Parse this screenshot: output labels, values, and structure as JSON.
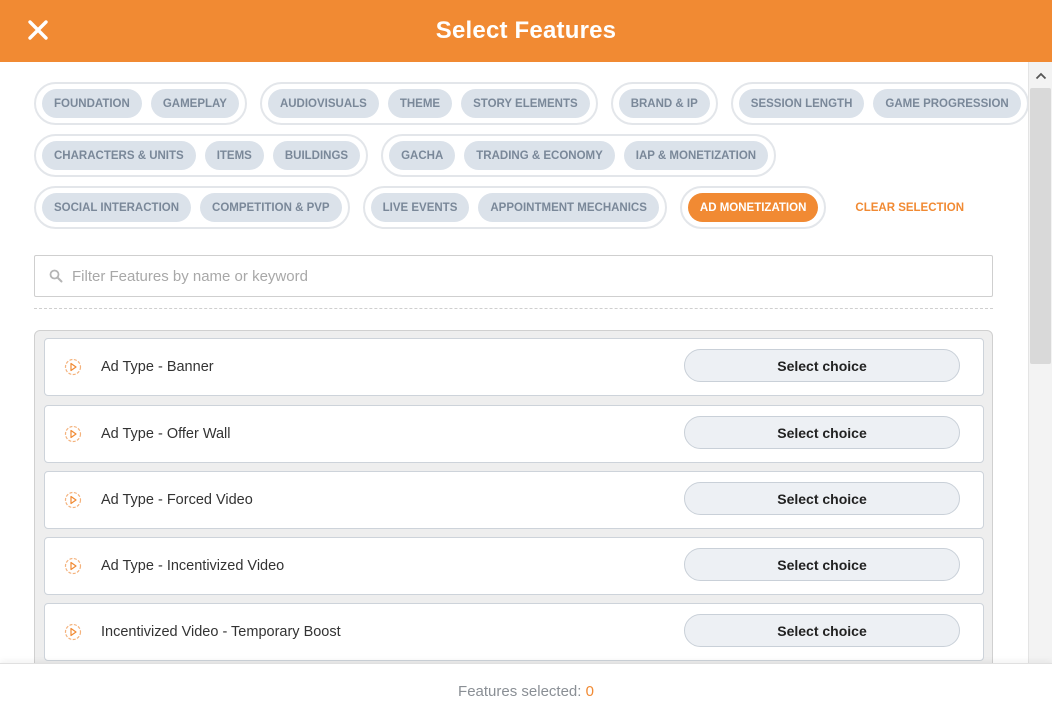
{
  "header": {
    "title": "Select Features",
    "close_icon": "close-icon",
    "background": "#F18A33"
  },
  "category_groups": [
    {
      "chips": [
        "FOUNDATION",
        "GAMEPLAY"
      ]
    },
    {
      "chips": [
        "AUDIOVISUALS",
        "THEME",
        "STORY ELEMENTS"
      ]
    },
    {
      "chips": [
        "BRAND & IP"
      ]
    },
    {
      "chips": [
        "SESSION LENGTH",
        "GAME PROGRESSION"
      ]
    },
    {
      "chips": [
        "CHARACTERS & UNITS",
        "ITEMS",
        "BUILDINGS"
      ]
    },
    {
      "chips": [
        "GACHA",
        "TRADING & ECONOMY",
        "IAP & MONETIZATION"
      ]
    },
    {
      "chips": [
        "SOCIAL INTERACTION",
        "COMPETITION & PVP"
      ]
    },
    {
      "chips": [
        "LIVE EVENTS",
        "APPOINTMENT MECHANICS"
      ]
    },
    {
      "chips": [
        "AD MONETIZATION"
      ],
      "active": true
    }
  ],
  "clear_selection_label": "CLEAR SELECTION",
  "search": {
    "placeholder": "Filter Features by name or keyword",
    "value": ""
  },
  "features": [
    {
      "name": "Ad Type - Banner",
      "button": "Select choice"
    },
    {
      "name": "Ad Type - Offer Wall",
      "button": "Select choice"
    },
    {
      "name": "Ad Type - Forced Video",
      "button": "Select choice"
    },
    {
      "name": "Ad Type - Incentivized Video",
      "button": "Select choice"
    },
    {
      "name": "Incentivized Video - Temporary Boost",
      "button": "Select choice"
    }
  ],
  "footer": {
    "label": "Features selected:",
    "count": "0"
  },
  "colors": {
    "accent": "#F18A33",
    "chip_bg": "#dbe2ea",
    "chip_text": "#7a8899"
  }
}
